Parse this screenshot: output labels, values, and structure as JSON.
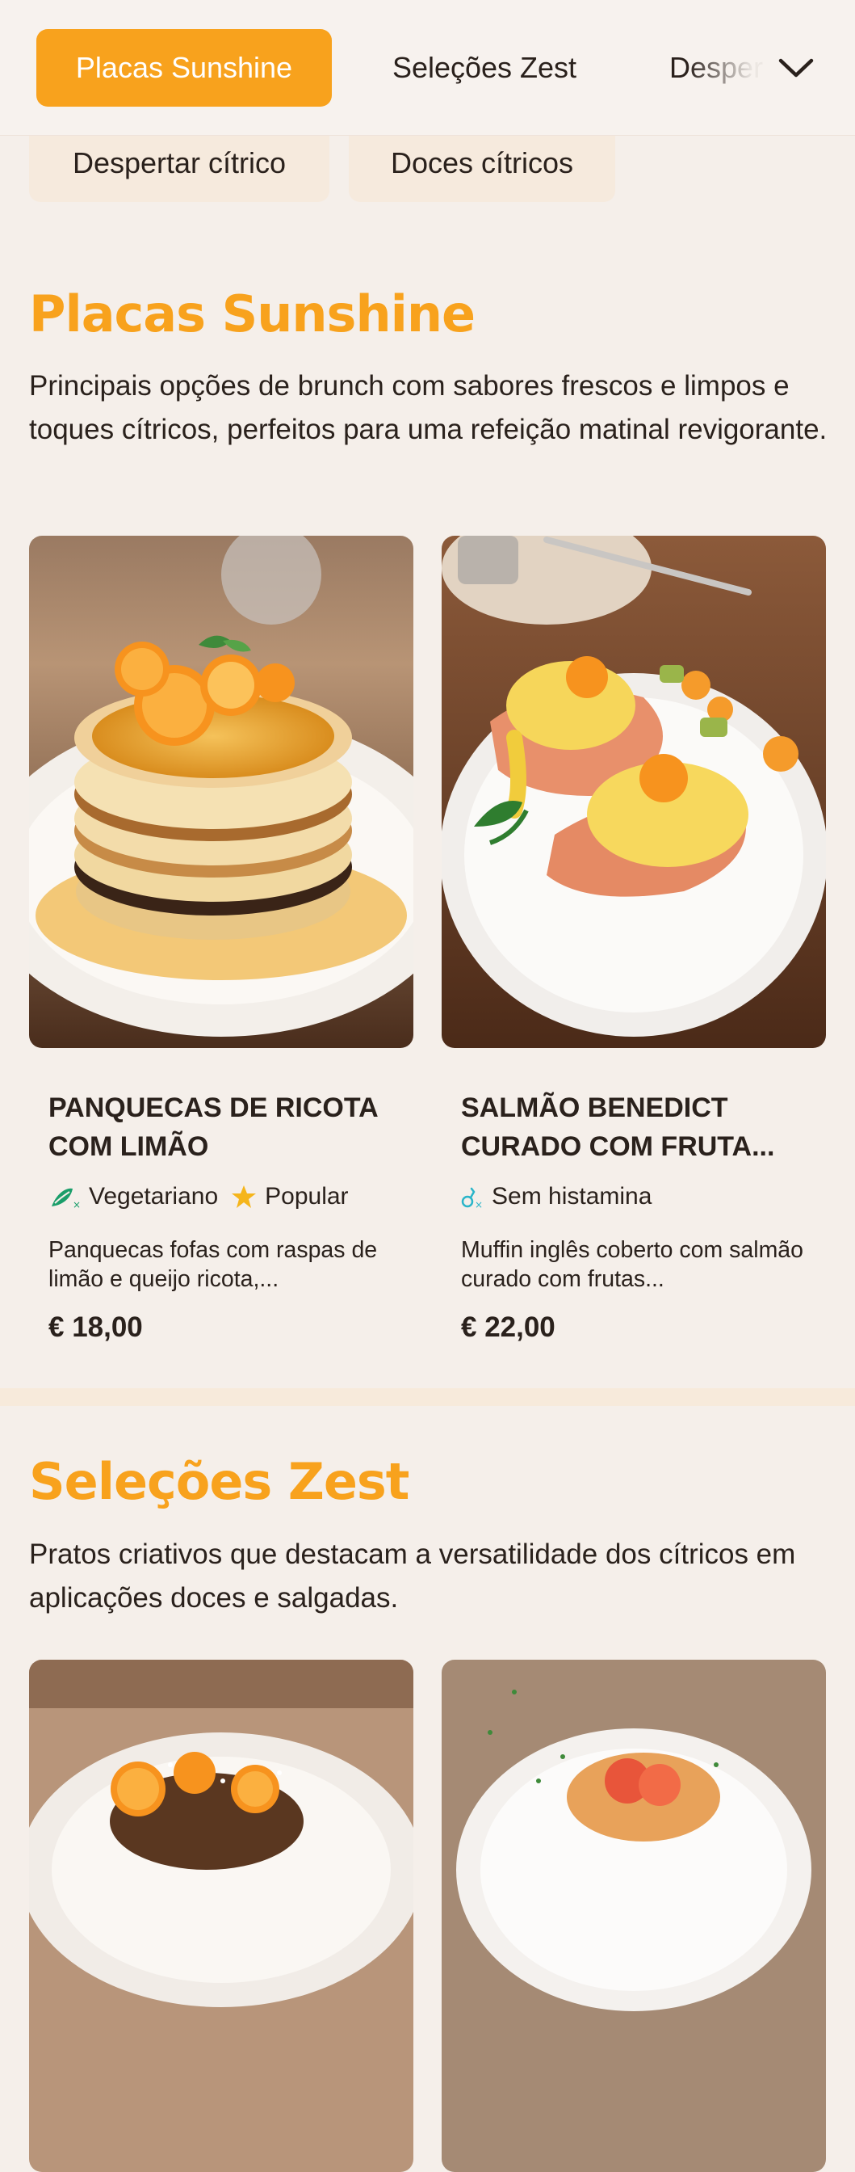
{
  "nav": {
    "tabs": [
      {
        "label": "Placas Sunshine",
        "active": true
      },
      {
        "label": "Seleções Zest",
        "active": false
      },
      {
        "label": "Desper",
        "active": false
      }
    ],
    "more_icon": "chevron-down-icon",
    "row2": [
      {
        "label": "Despertar cítrico"
      },
      {
        "label": "Doces cítricos"
      }
    ]
  },
  "sections": [
    {
      "title": "Placas Sunshine",
      "description": "Principais opções de brunch com sabores frescos e limpos e toques cítricos, perfeitos para uma refeição matinal revigorante.",
      "items": [
        {
          "name": "PANQUECAS DE RICOTA COM LIMÃO",
          "tags": [
            {
              "icon": "vegetarian-icon",
              "label": "Vegetariano",
              "color": "#1a9e6a"
            },
            {
              "icon": "star-icon",
              "label": "Popular",
              "color": "#f5b51b"
            }
          ],
          "description": "Panquecas fofas com raspas de limão e queijo ricota,...",
          "price": "€ 18,00",
          "image": "lemon-ricotta-pancakes-photo"
        },
        {
          "name": "SALMÃO BENEDICT CURADO COM FRUTA...",
          "tags": [
            {
              "icon": "histamine-free-icon",
              "label": "Sem histamina",
              "color": "#2bb5c9"
            }
          ],
          "description": "Muffin inglês coberto com salmão curado com frutas...",
          "price": "€ 22,00",
          "image": "salmon-benedict-photo"
        }
      ]
    },
    {
      "title": "Seleções Zest",
      "description": "Pratos criativos que destacam a versatilidade dos cítricos em aplicações doces e salgadas.",
      "items": [
        {
          "image": "citrus-french-toast-photo"
        },
        {
          "image": "citrus-salad-plate-photo"
        }
      ]
    }
  ],
  "colors": {
    "accent": "#f8a21d",
    "background": "#f5efea",
    "chip": "#f6eadd",
    "text": "#2a211c"
  }
}
